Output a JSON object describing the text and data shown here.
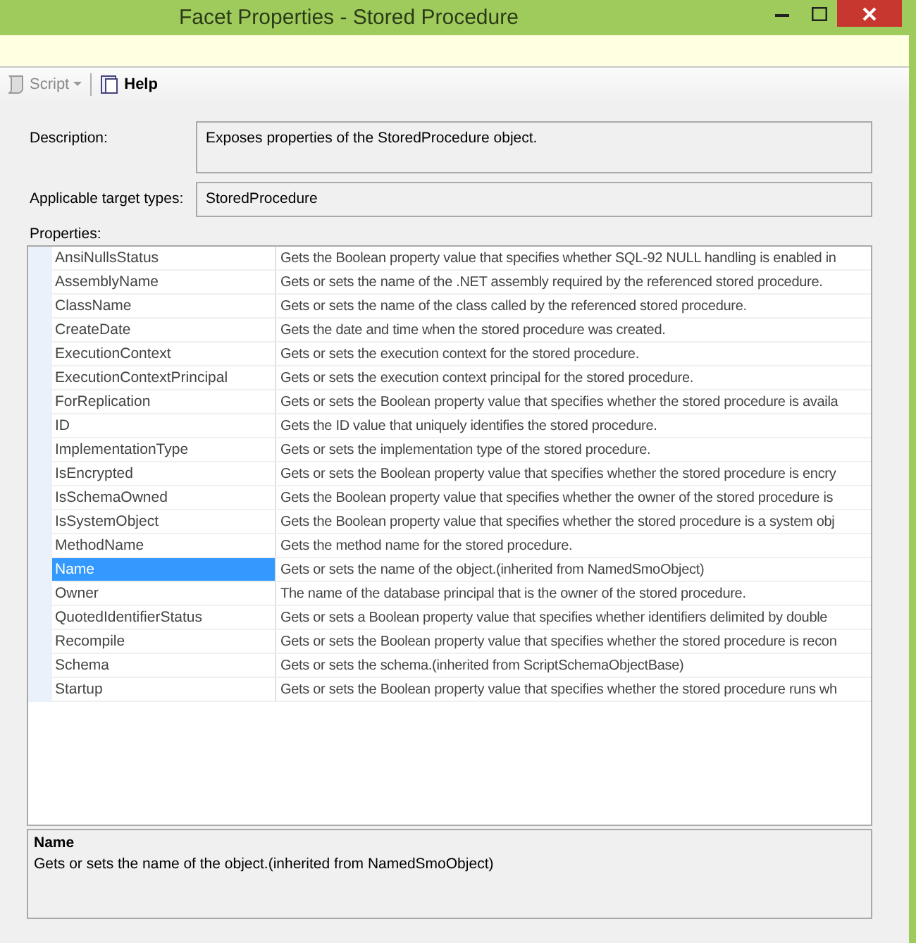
{
  "window": {
    "title": "Facet Properties - Stored Procedure"
  },
  "toolbar": [
    {
      "kind": "script",
      "label": "Script",
      "disabled": true
    },
    {
      "kind": "help",
      "label": "Help",
      "disabled": false
    }
  ],
  "description": {
    "label": "Description:",
    "value": "Exposes properties of the StoredProcedure object."
  },
  "target_types": {
    "label": "Applicable target types:",
    "value": "StoredProcedure"
  },
  "properties": {
    "label": "Properties:",
    "rows": [
      {
        "name": "AnsiNullsStatus",
        "description": "Gets the Boolean property value that specifies whether SQL-92 NULL handling is enabled in",
        "selected": false
      },
      {
        "name": "AssemblyName",
        "description": "Gets or sets the name of the .NET assembly required by the referenced stored procedure.",
        "selected": false
      },
      {
        "name": "ClassName",
        "description": "Gets or sets the name of the class called by the referenced stored procedure.",
        "selected": false
      },
      {
        "name": "CreateDate",
        "description": "Gets the date and time when the stored procedure was created.",
        "selected": false
      },
      {
        "name": "ExecutionContext",
        "description": "Gets or sets the execution context for the stored procedure.",
        "selected": false
      },
      {
        "name": "ExecutionContextPrincipal",
        "description": "Gets or sets the execution context principal for the stored procedure.",
        "selected": false
      },
      {
        "name": "ForReplication",
        "description": "Gets or sets the Boolean property value that specifies whether the stored procedure is availa",
        "selected": false
      },
      {
        "name": "ID",
        "description": "Gets the ID value that uniquely identifies the stored procedure.",
        "selected": false
      },
      {
        "name": "ImplementationType",
        "description": "Gets or sets the implementation type of the stored procedure.",
        "selected": false
      },
      {
        "name": "IsEncrypted",
        "description": "Gets or sets the Boolean property value that specifies whether the stored procedure is encry",
        "selected": false
      },
      {
        "name": "IsSchemaOwned",
        "description": "Gets the Boolean property value that specifies whether the owner of the stored procedure is",
        "selected": false
      },
      {
        "name": "IsSystemObject",
        "description": "Gets the Boolean property value that specifies whether the stored procedure is a system obj",
        "selected": false
      },
      {
        "name": "MethodName",
        "description": "Gets the method name for the stored procedure.",
        "selected": false
      },
      {
        "name": "Name",
        "description": "Gets or sets the name of the object.(inherited from NamedSmoObject)",
        "selected": true
      },
      {
        "name": "Owner",
        "description": "The name of the database principal that is the owner of the stored procedure.",
        "selected": false
      },
      {
        "name": "QuotedIdentifierStatus",
        "description": "Gets or sets a Boolean property value that specifies whether identifiers delimited by double",
        "selected": false
      },
      {
        "name": "Recompile",
        "description": "Gets or sets the Boolean property value that specifies whether the stored procedure is recon",
        "selected": false
      },
      {
        "name": "Schema",
        "description": "Gets or sets the schema.(inherited from ScriptSchemaObjectBase)",
        "selected": false
      },
      {
        "name": "Startup",
        "description": "Gets or sets the Boolean property value that specifies whether the stored procedure runs wh",
        "selected": false
      }
    ]
  },
  "details": {
    "title": "Name",
    "text": "Gets or sets the name of the object.(inherited from NamedSmoObject)"
  }
}
